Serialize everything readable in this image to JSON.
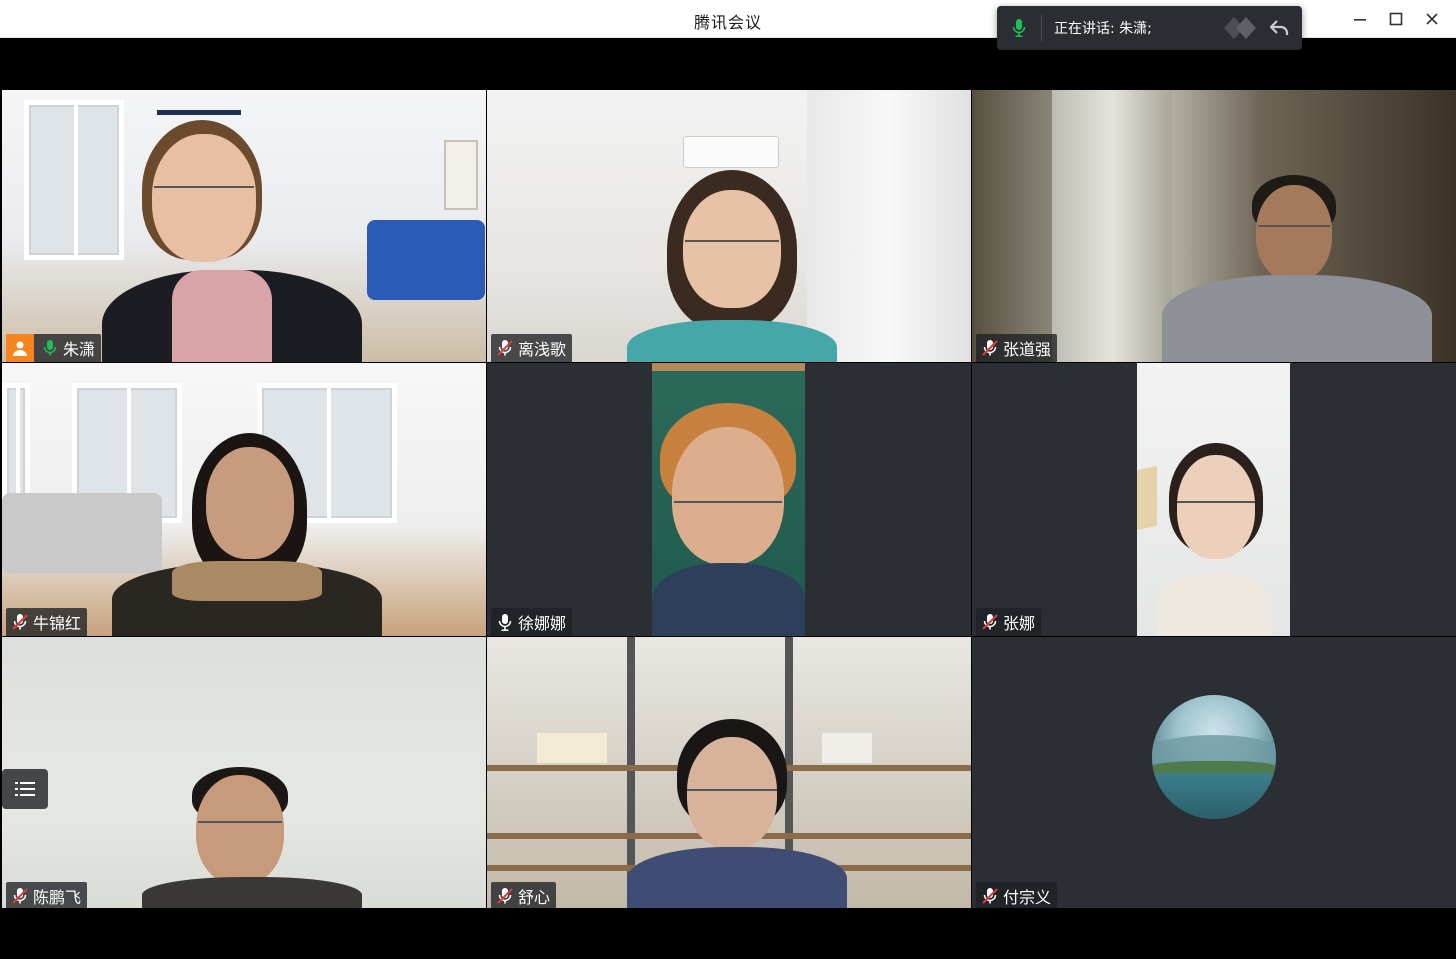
{
  "window": {
    "title": "腾讯会议",
    "minimize_icon": "minimize-icon",
    "maximize_icon": "maximize-icon",
    "close_icon": "close-icon"
  },
  "speaking": {
    "text": "正在讲话: 朱潇;",
    "mic_icon": "mic-on-icon",
    "back_icon": "return-icon",
    "accent": "#1fc05a"
  },
  "participants": [
    {
      "name": "朱潇",
      "mic": "on",
      "host": true
    },
    {
      "name": "离浅歌",
      "mic": "muted"
    },
    {
      "name": "张道强",
      "mic": "muted"
    },
    {
      "name": "牛锦红",
      "mic": "muted"
    },
    {
      "name": "徐娜娜",
      "mic": "on-idle"
    },
    {
      "name": "张娜",
      "mic": "muted"
    },
    {
      "name": "陈鹏飞",
      "mic": "muted"
    },
    {
      "name": "舒心",
      "mic": "muted"
    },
    {
      "name": "付宗义",
      "mic": "muted",
      "video": false
    }
  ],
  "colors": {
    "host_badge": "#f6851f",
    "muted_red": "#e03b3b",
    "label_bg": "#1e2024",
    "tile_bg": "#2b2e33"
  }
}
